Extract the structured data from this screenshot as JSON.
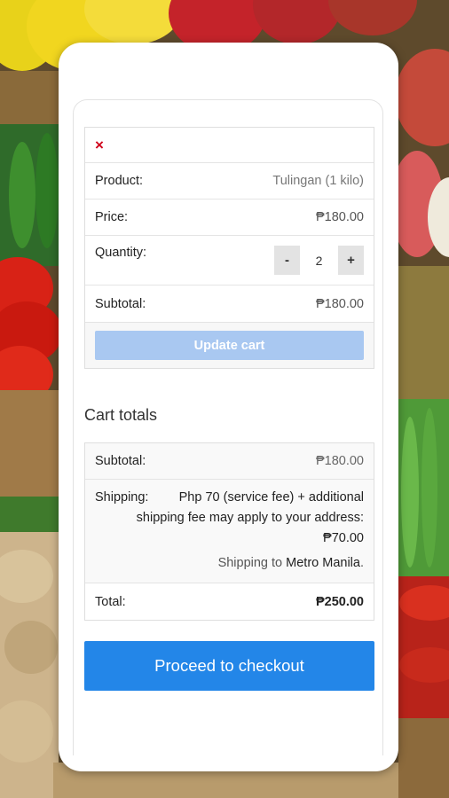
{
  "cart": {
    "remove_symbol": "×",
    "product_label": "Product:",
    "product_value": "Tulingan (1 kilo)",
    "price_label": "Price:",
    "price_value": "₱180.00",
    "quantity_label": "Quantity:",
    "quantity_minus": "-",
    "quantity_value": "2",
    "quantity_plus": "+",
    "subtotal_label": "Subtotal:",
    "subtotal_value": "₱180.00",
    "update_button": "Update cart"
  },
  "totals": {
    "title": "Cart totals",
    "subtotal_label": "Subtotal:",
    "subtotal_value": "₱180.00",
    "shipping_label": "Shipping:",
    "shipping_line1": "Php 70 (service fee) + additional",
    "shipping_line2": "shipping fee may apply to your address:",
    "shipping_amount": "₱70.00",
    "shipping_to_prefix": "Shipping to",
    "shipping_to_place": "Metro Manila",
    "shipping_to_suffix": ".",
    "total_label": "Total:",
    "total_value": "₱250.00"
  },
  "checkout": {
    "button_label": "Proceed to checkout"
  },
  "colors": {
    "checkout_blue": "#2386e8",
    "update_button_disabled": "#a9c8f1",
    "remove_red": "#d0021b"
  }
}
